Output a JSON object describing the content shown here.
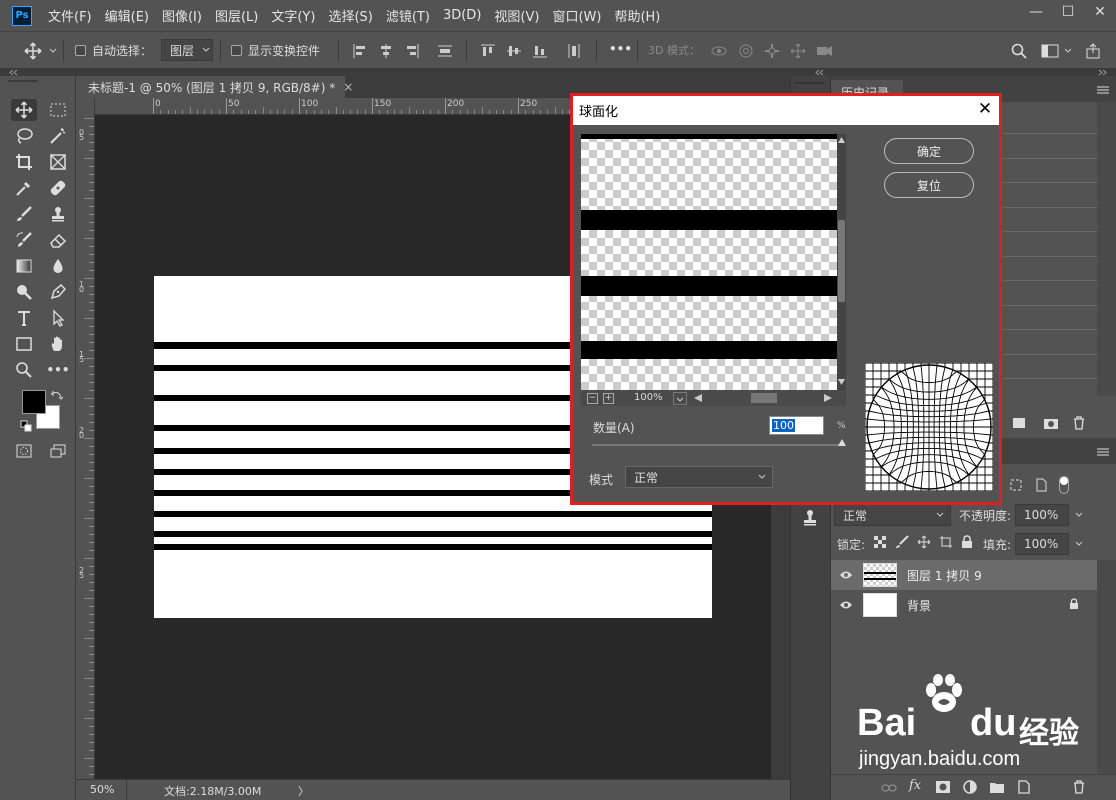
{
  "app": {
    "logo": "Ps"
  },
  "menu": [
    "文件(F)",
    "编辑(E)",
    "图像(I)",
    "图层(L)",
    "文字(Y)",
    "选择(S)",
    "滤镜(T)",
    "3D(D)",
    "视图(V)",
    "窗口(W)",
    "帮助(H)"
  ],
  "window_controls": {
    "minimize": "—",
    "maximize": "☐",
    "close": "✕"
  },
  "options": {
    "auto_select_label": "自动选择：",
    "auto_select_value": "图层",
    "show_transform_label": "显示变换控件",
    "more": "•••",
    "mode_3d_label": "3D 模式："
  },
  "document": {
    "tab_title": "未标题-1 @ 50% (图层 1 拷贝 9, RGB/8#) *",
    "tab_close": "×",
    "ruler_h": [
      "0",
      "50",
      "100",
      "150",
      "200",
      "250"
    ],
    "ruler_v": [
      "0",
      "5",
      "1",
      "0",
      "1",
      "5",
      "2",
      "0",
      "2",
      "5"
    ],
    "stripe_count": 10
  },
  "status": {
    "zoom": "50%",
    "doc_info": "文档:2.18M/3.00M",
    "arrow": "〉"
  },
  "right_panel": {
    "history_tab": "历史记录",
    "blend_mode": "正常",
    "opacity_label": "不透明度:",
    "opacity_value": "100%",
    "lock_label": "锁定:",
    "fill_label": "填充:",
    "fill_value": "100%",
    "layers": [
      {
        "name": "图层 1 拷贝 9",
        "selected": true,
        "locked": false
      },
      {
        "name": "背景",
        "selected": false,
        "locked": true
      }
    ]
  },
  "dialog": {
    "title": "球面化",
    "close": "✕",
    "ok": "确定",
    "reset": "复位",
    "zoom_value": "100%",
    "zoom_minus": "−",
    "zoom_plus": "+",
    "amount_label": "数量(A)",
    "amount_value": "100",
    "amount_unit": "%",
    "amount_fraction": 1.0,
    "mode_label": "模式",
    "mode_value": "正常"
  },
  "watermark": {
    "brand": "Bai",
    "brand_end": "du",
    "brand_cn": "经验",
    "url": "jingyan.baidu.com"
  }
}
